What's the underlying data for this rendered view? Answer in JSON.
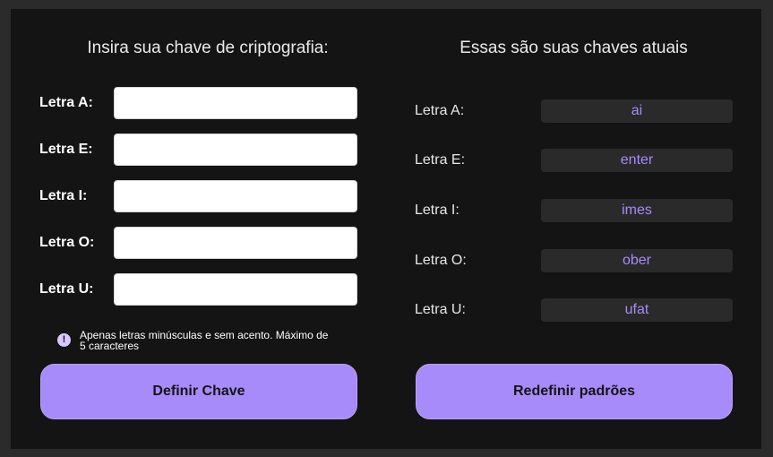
{
  "form": {
    "heading": "Insira sua chave de criptografia:",
    "fields": [
      {
        "label": "Letra A:",
        "value": ""
      },
      {
        "label": "Letra E:",
        "value": ""
      },
      {
        "label": "Letra I:",
        "value": ""
      },
      {
        "label": "Letra O:",
        "value": ""
      },
      {
        "label": "Letra U:",
        "value": ""
      }
    ],
    "hint": "Apenas letras minúsculas e sem acento. Máximo de 5 caracteres",
    "hint_icon": "exclamation-icon",
    "submit_label": "Definir Chave"
  },
  "current": {
    "heading": "Essas são suas chaves atuais",
    "keys": [
      {
        "label": "Letra A:",
        "value": "ai"
      },
      {
        "label": "Letra E:",
        "value": "enter"
      },
      {
        "label": "Letra I:",
        "value": "imes"
      },
      {
        "label": "Letra O:",
        "value": "ober"
      },
      {
        "label": "Letra U:",
        "value": "ufat"
      }
    ],
    "reset_label": "Redefinir padrões"
  },
  "colors": {
    "accent": "#a78bfa",
    "background": "#141414",
    "frame": "#2b2b2b"
  }
}
